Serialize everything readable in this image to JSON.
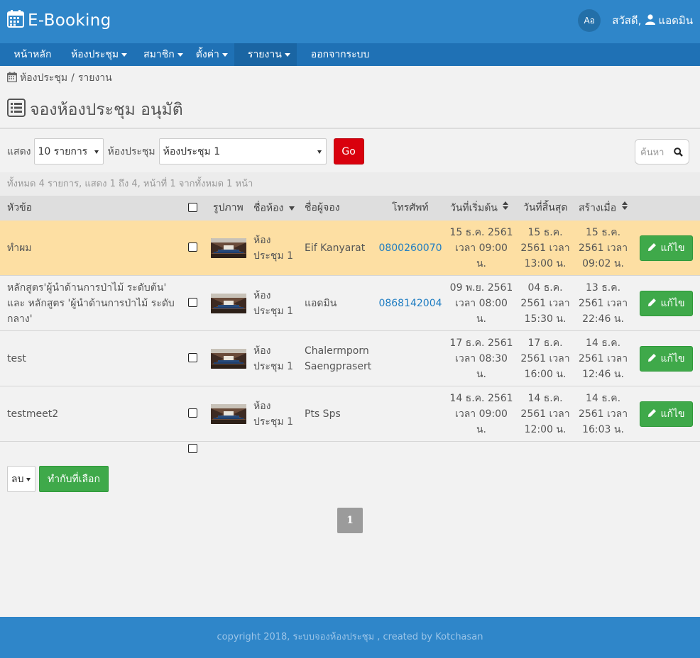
{
  "app": {
    "title": "E-Booking"
  },
  "header": {
    "greeting": "สวัสดี,",
    "user": "แอดมิน",
    "lang_label": "Aอ"
  },
  "nav": [
    {
      "label": "หน้าหลัก",
      "dropdown": false,
      "active": false
    },
    {
      "label": "ห้องประชุม",
      "dropdown": true,
      "active": false
    },
    {
      "label": "สมาชิก",
      "dropdown": true,
      "active": false
    },
    {
      "label": "ตั้งค่า",
      "dropdown": true,
      "active": false
    },
    {
      "label": "รายงาน",
      "dropdown": true,
      "active": true
    },
    {
      "label": "ออกจากระบบ",
      "dropdown": false,
      "active": false
    }
  ],
  "breadcrumb": {
    "item1": "ห้องประชุม",
    "separator": "/",
    "item2": "รายงาน"
  },
  "page": {
    "title": "จองห้องประชุม อนุมัติ"
  },
  "filters": {
    "show_label": "แสดง",
    "per_page_value": "10 รายการ",
    "room_label": "ห้องประชุม",
    "room_value": "ห้องประชุม 1",
    "go_label": "Go",
    "search_placeholder": "ค้นหา"
  },
  "summary": "ทั้งหมด 4 รายการ, แสดง 1 ถึง 4, หน้าที่ 1 จากทั้งหมด 1 หน้า",
  "table": {
    "headers": {
      "topic": "หัวข้อ",
      "image": "รูปภาพ",
      "room": "ชื่อห้อง",
      "booker": "ชื่อผู้จอง",
      "phone": "โทรศัพท์",
      "begin": "วันที่เริ่มต้น",
      "end": "วันที่สิ้นสุด",
      "created": "สร้างเมื่อ"
    },
    "edit_label": "แก้ไข",
    "rows": [
      {
        "topic_1": "ทำผม",
        "topic_2": "",
        "topic_3": "",
        "room_1": "ห้อง",
        "room_2": "ประชุม 1",
        "booker_1": "Eif Kanyarat",
        "booker_2": "",
        "phone": "0800260070",
        "begin_1": "15 ธ.ค. 2561",
        "begin_2": "เวลา 09:00",
        "begin_3": "น.",
        "end_1": "15 ธ.ค.",
        "end_2": "2561 เวลา",
        "end_3": "13:00 น.",
        "created_1": "15 ธ.ค.",
        "created_2": "2561 เวลา",
        "created_3": "09:02 น."
      },
      {
        "topic_1": "หลักสูตร'ผู้นำด้านการป่าไม้ ระดับต้น'",
        "topic_2": "และ หลักสูตร 'ผู้นำด้านการป่าไม้ ระดับ",
        "topic_3": "กลาง'",
        "room_1": "ห้อง",
        "room_2": "ประชุม 1",
        "booker_1": "แอดมิน",
        "booker_2": "",
        "phone": "0868142004",
        "begin_1": "09 พ.ย. 2561",
        "begin_2": "เวลา 08:00",
        "begin_3": "น.",
        "end_1": "04 ธ.ค.",
        "end_2": "2561 เวลา",
        "end_3": "15:30 น.",
        "created_1": "13 ธ.ค.",
        "created_2": "2561 เวลา",
        "created_3": "22:46 น."
      },
      {
        "topic_1": "test",
        "topic_2": "",
        "topic_3": "",
        "room_1": "ห้อง",
        "room_2": "ประชุม 1",
        "booker_1": "Chalermporn",
        "booker_2": "Saengprasert",
        "phone": "",
        "begin_1": "17 ธ.ค. 2561",
        "begin_2": "เวลา 08:30",
        "begin_3": "น.",
        "end_1": "17 ธ.ค.",
        "end_2": "2561 เวลา",
        "end_3": "16:00 น.",
        "created_1": "14 ธ.ค.",
        "created_2": "2561 เวลา",
        "created_3": "12:46 น."
      },
      {
        "topic_1": "testmeet2",
        "topic_2": "",
        "topic_3": "",
        "room_1": "ห้อง",
        "room_2": "ประชุม 1",
        "booker_1": "Pts Sps",
        "booker_2": "",
        "phone": "",
        "begin_1": "14 ธ.ค. 2561",
        "begin_2": "เวลา 09:00",
        "begin_3": "น.",
        "end_1": "14 ธ.ค.",
        "end_2": "2561 เวลา",
        "end_3": "12:00 น.",
        "created_1": "14 ธ.ค.",
        "created_2": "2561 เวลา",
        "created_3": "16:03 น."
      }
    ]
  },
  "bulk": {
    "action_value": "ลบ",
    "apply_label": "ทำกับที่เลือก"
  },
  "pagination": {
    "current": "1"
  },
  "footer": {
    "text": "copyright 2018, ระบบจองห้องประชุม , created by Kotchasan"
  },
  "colors": {
    "header": "#2f86c9",
    "nav": "#1f71b5",
    "go": "#d9000d",
    "success": "#3fa94a",
    "highlight": "#fddfa3"
  },
  "icons": {
    "logo": "calendar-icon",
    "title": "list-icon",
    "user": "user-icon",
    "search": "search-icon",
    "edit": "pencil-icon",
    "sort": "sort-icon"
  }
}
